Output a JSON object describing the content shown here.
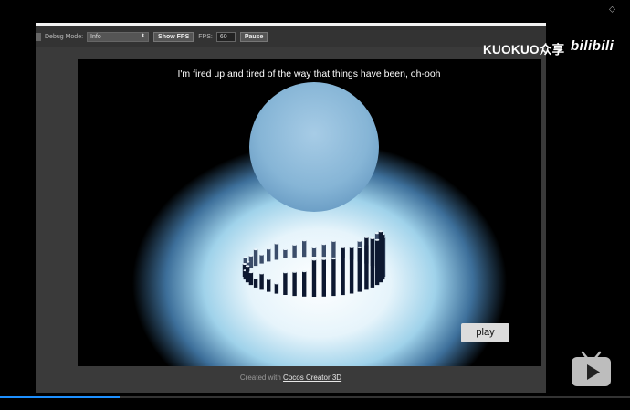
{
  "toolbar": {
    "debug_label": "Debug Mode:",
    "debug_value": "Info",
    "show_fps_label": "Show FPS",
    "fps_label": "FPS:",
    "fps_value": "60",
    "pause_label": "Pause"
  },
  "game": {
    "lyric": "I'm fired up and tired of the way that things have been, oh-ooh",
    "play_label": "play"
  },
  "credits": {
    "prefix": "Created with ",
    "link": "Cocos Creator 3D"
  },
  "watermark": {
    "text": "KUOKUO众享",
    "logo": "bilibili"
  },
  "video": {
    "progress_fraction": 0.19
  },
  "colors": {
    "progress": "#1e90ff",
    "sphere": "#8ab8d8"
  },
  "icons": [
    "pin-icon",
    "bilibili-tv-icon",
    "dropdown-arrow-icon"
  ]
}
